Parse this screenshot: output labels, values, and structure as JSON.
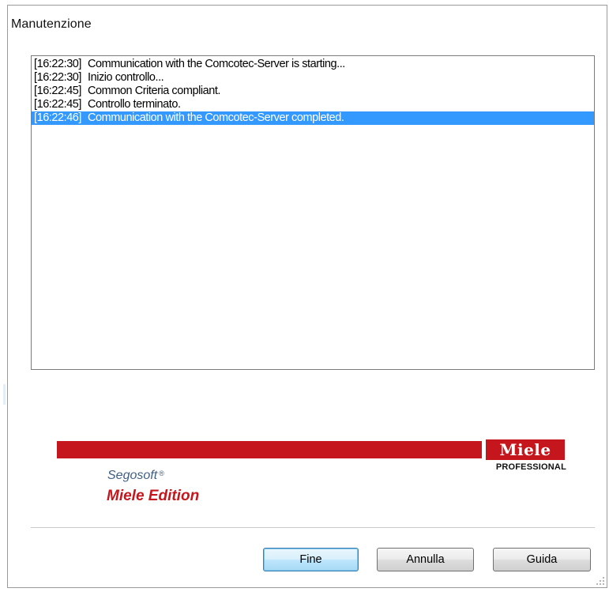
{
  "dialog": {
    "title": "Manutenzione"
  },
  "log": {
    "entries": [
      {
        "time": "[16:22:30]",
        "message": "Communication with the Comcotec-Server is starting..."
      },
      {
        "time": "[16:22:30]",
        "message": "Inizio controllo..."
      },
      {
        "time": "[16:22:45]",
        "message": "Common Criteria compliant."
      },
      {
        "time": "[16:22:45]",
        "message": "Controllo terminato."
      },
      {
        "time": "[16:22:46]",
        "message": "Communication with the Comcotec-Server completed."
      }
    ],
    "selected_index": 4,
    "selection_color": "#3399ff"
  },
  "branding": {
    "logo_text": "Miele",
    "logo_sub": "PROFESSIONAL",
    "product_name": "Segosoft",
    "product_mark": "®",
    "edition": "Miele Edition",
    "brand_color": "#c4161c",
    "product_color": "#3f5f86"
  },
  "buttons": {
    "finish": "Fine",
    "cancel": "Annulla",
    "help": "Guida"
  }
}
